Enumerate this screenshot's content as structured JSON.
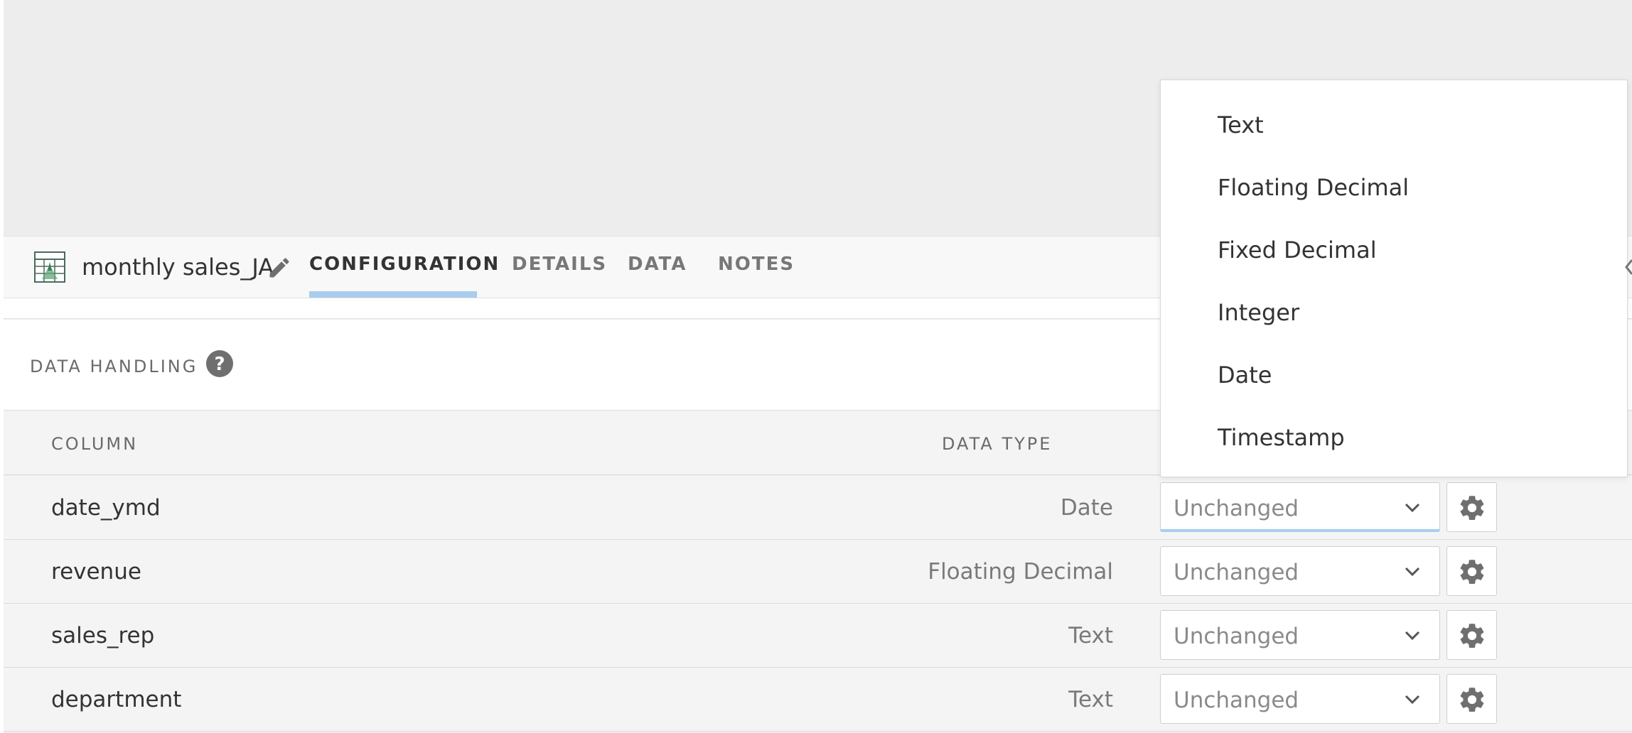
{
  "dataset": {
    "name": "monthly sales_JA"
  },
  "tabs": [
    {
      "label": "CONFIGURATION",
      "active": true
    },
    {
      "label": "DETAILS",
      "active": false
    },
    {
      "label": "DATA",
      "active": false
    },
    {
      "label": "NOTES",
      "active": false
    }
  ],
  "panel": {
    "title": "DATA HANDLING"
  },
  "table": {
    "headers": {
      "column": "COLUMN",
      "data_type": "DATA TYPE"
    },
    "rows": [
      {
        "column": "date_ymd",
        "type": "Date",
        "selection": "Unchanged"
      },
      {
        "column": "revenue",
        "type": "Floating Decimal",
        "selection": "Unchanged"
      },
      {
        "column": "sales_rep",
        "type": "Text",
        "selection": "Unchanged"
      },
      {
        "column": "department",
        "type": "Text",
        "selection": "Unchanged"
      }
    ]
  },
  "dropdown": {
    "options": [
      "Text",
      "Floating Decimal",
      "Fixed Decimal",
      "Integer",
      "Date",
      "Timestamp"
    ]
  },
  "colors": {
    "accent_underline": "#a8cdee",
    "icon_gray": "#6f6f6f",
    "background": "#ededed"
  }
}
